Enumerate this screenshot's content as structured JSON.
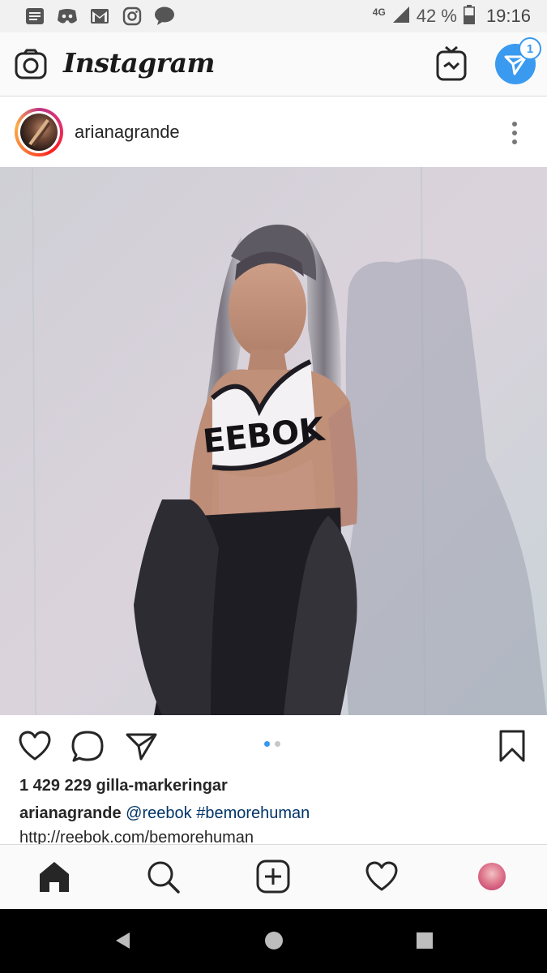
{
  "status_bar": {
    "network": "4G",
    "battery": "42 %",
    "time": "19:16",
    "notification_icons": [
      "messages-icon",
      "discord-icon",
      "gmail-icon",
      "instagram-icon",
      "chat-bubble-icon"
    ]
  },
  "app_bar": {
    "logo": "Instagram",
    "direct_badge_count": "1",
    "colors": {
      "direct": "#3a9aef"
    }
  },
  "post": {
    "username": "arianagrande",
    "photo_text": "EEBOK",
    "carousel": {
      "count": 2,
      "active_index": 0,
      "active_color": "#3897f0",
      "inactive_color": "#c7c7c7"
    },
    "likes": "1 429 229 gilla-markeringar",
    "caption": {
      "username": "arianagrande",
      "mention": "@reebok",
      "hashtag": "#bemorehuman"
    },
    "link": "http://reebok.com/bemorehuman"
  },
  "bottom_nav": {
    "items": [
      "home-icon",
      "search-icon",
      "new-post-icon",
      "activity-heart-icon",
      "profile-avatar"
    ]
  }
}
